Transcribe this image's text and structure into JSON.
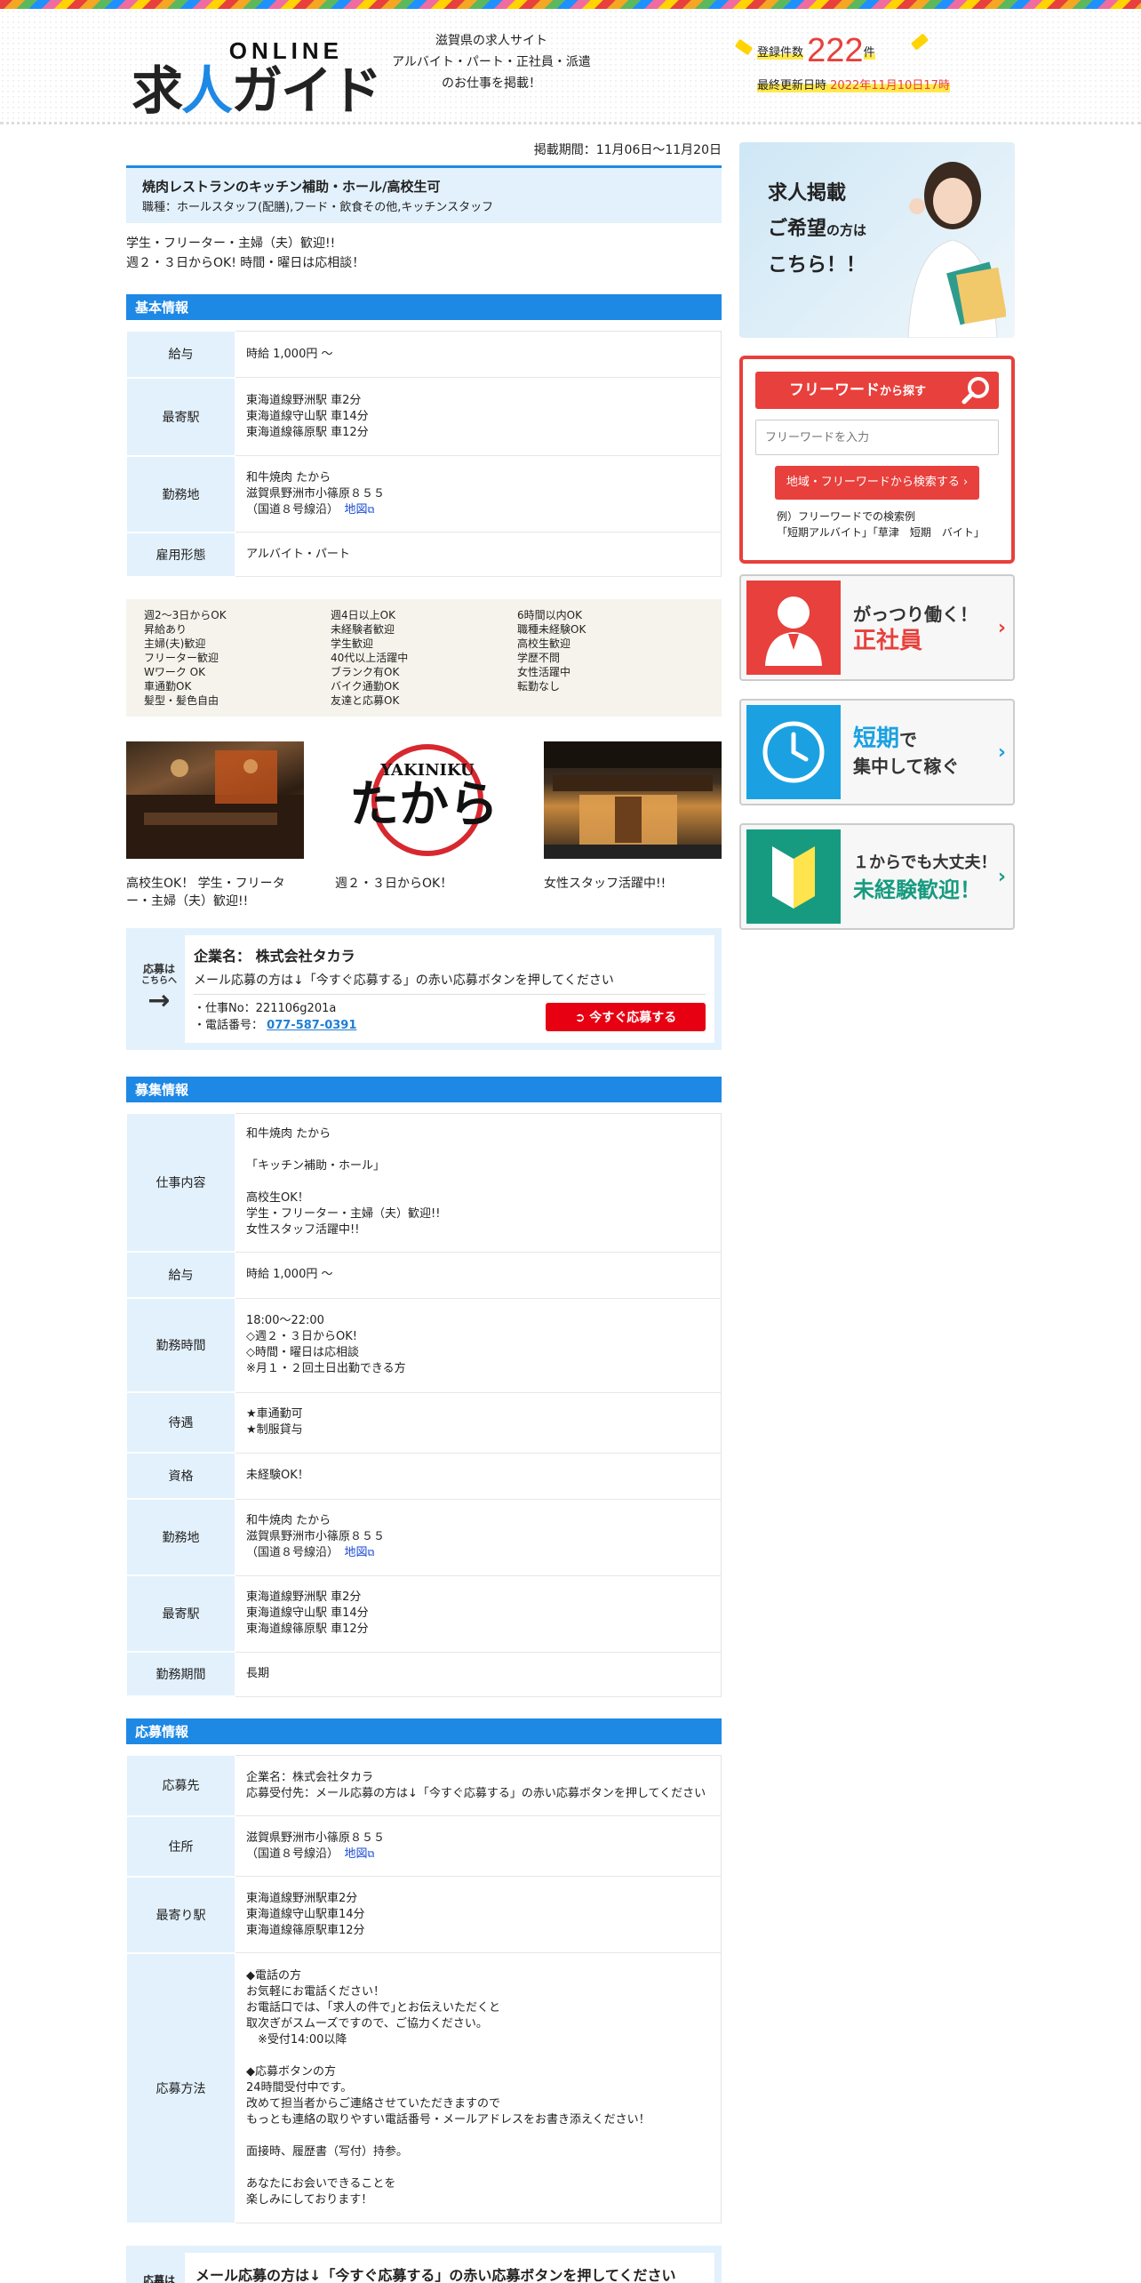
{
  "header": {
    "logo_online": "ONLINE",
    "logo_main_1": "求",
    "logo_main_2": "人",
    "logo_main_3": "ガイド",
    "tagline_1": "滋賀県の求人サイト",
    "tagline_2": "アルバイト・パート・正社員・派遣",
    "tagline_3": "のお仕事を掲載！",
    "count_label": "登録件数",
    "count": "222",
    "count_unit": "件",
    "updated_label": "最終更新日時",
    "updated": "2022年11月10日17時"
  },
  "job": {
    "period": "掲載期間：11月06日～11月20日",
    "title": "焼肉レストランのキッチン補助・ホール/高校生可",
    "subtitle": "職種：ホールスタッフ(配膳),フード・飲食その他,キッチンスタッフ",
    "catch_1": "学生・フリーター・主婦（夫）歓迎!!",
    "catch_2": "週２・３日からOK! 時間・曜日は応相談！"
  },
  "basic": {
    "heading": "基本情報",
    "rows": [
      {
        "label": "給与",
        "value": "時給 1,000円 ～"
      },
      {
        "label": "最寄駅",
        "value": "東海道線野洲駅 車2分\n東海道線守山駅 車14分\n東海道線篠原駅 車12分"
      },
      {
        "label": "勤務地",
        "value": "和牛焼肉 たから\n滋賀県野洲市小篠原８５５\n（国道８号線沿）",
        "map": "地図"
      },
      {
        "label": "雇用形態",
        "value": "アルバイト・パート"
      }
    ]
  },
  "tags": [
    "週2～3日からOK",
    "昇給あり",
    "主婦(夫)歓迎",
    "フリーター歓迎",
    "Wワーク OK",
    "車通勤OK",
    "髪型・髪色自由",
    "週4日以上OK",
    "未経験者歓迎",
    "学生歓迎",
    "40代以上活躍中",
    "ブランク有OK",
    "バイク通勤OK",
    "友達と応募OK",
    "6時間以内OK",
    "職種未経験OK",
    "高校生歓迎",
    "学歴不問",
    "女性活躍中",
    "転勤なし"
  ],
  "photos": [
    {
      "caption": "高校生OK！ 学生・フリーター・主婦（夫）歓迎!!"
    },
    {
      "caption": "週２・３日からOK！",
      "logo_top": "YAKINIKU",
      "logo_main": "たから"
    },
    {
      "caption": "女性スタッフ活躍中!!"
    }
  ],
  "apply_box": {
    "side_label_1": "応募は",
    "side_label_2": "こちらへ",
    "company": "企業名： 株式会社タカラ",
    "note": "メール応募の方は↓「今すぐ応募する」の赤い応募ボタンを押してください",
    "job_no": "・仕事No：221106g201a",
    "tel_label": "・電話番号：",
    "tel": "077-587-0391",
    "button": "今すぐ応募する"
  },
  "recruit": {
    "heading": "募集情報",
    "rows": [
      {
        "label": "仕事内容",
        "value": "和牛焼肉 たから\n\n「キッチン補助・ホール」\n\n高校生OK！\n学生・フリーター・主婦（夫）歓迎!!\n女性スタッフ活躍中!!"
      },
      {
        "label": "給与",
        "value": "時給 1,000円 ～"
      },
      {
        "label": "勤務時間",
        "value": "18:00～22:00\n◇週２・３日からOK!\n◇時間・曜日は応相談\n※月１・２回土日出勤できる方"
      },
      {
        "label": "待遇",
        "value": "★車通勤可\n★制服貸与"
      },
      {
        "label": "資格",
        "value": "未経験OK！"
      },
      {
        "label": "勤務地",
        "value": "和牛焼肉 たから\n滋賀県野洲市小篠原８５５\n（国道８号線沿）",
        "map": "地図"
      },
      {
        "label": "最寄駅",
        "value": "東海道線野洲駅 車2分\n東海道線守山駅 車14分\n東海道線篠原駅 車12分"
      },
      {
        "label": "勤務期間",
        "value": "長期"
      }
    ]
  },
  "application": {
    "heading": "応募情報",
    "rows": [
      {
        "label": "応募先",
        "value": "企業名：株式会社タカラ\n応募受付先：メール応募の方は↓「今すぐ応募する」の赤い応募ボタンを押してください"
      },
      {
        "label": "住所",
        "value": "滋賀県野洲市小篠原８５５\n（国道８号線沿）",
        "map": "地図"
      },
      {
        "label": "最寄り駅",
        "value": "東海道線野洲駅車2分\n東海道線守山駅車14分\n東海道線篠原駅車12分"
      },
      {
        "label": "応募方法",
        "value": "◆電話の方\nお気軽にお電話ください！\nお電話口では、｢求人の件で｣とお伝えいただくと\n取次ぎがスムーズですので、ご協力ください。\n　※受付14:00以降\n\n◆応募ボタンの方\n24時間受付中です。\n改めて担当者からご連絡させていただきますので\nもっとも連絡の取りやすい電話番号・メールアドレスをお書き添えください！\n\n面接時、履歴書（写付）持参。\n\nあなたにお会いできることを\n楽しみにしております！"
      }
    ]
  },
  "bottom_box": {
    "text": "メール応募の方は↓「今すぐ応募する」の赤い応募ボタンを押してください",
    "side_label": "応募は"
  },
  "sidebar": {
    "recruit_line1": "求人掲載",
    "recruit_line2a": "ご希望",
    "recruit_line2b": "の方は",
    "recruit_line3": "こちら！！",
    "search_title": "フリーワード",
    "search_title_small": "から探す",
    "search_placeholder": "フリーワードを入力",
    "search_button": "地域・フリーワードから検索する ›",
    "search_example": "例）フリーワードでの検索例\n「短期アルバイト」「草津　短期　バイト」",
    "banners": [
      {
        "line1": "がっつり働く！",
        "line2": "正社員",
        "color": "#e8403c"
      },
      {
        "line1a": "短期",
        "line1b": "で",
        "line2": "集中して稼ぐ",
        "color": "#1ba1e2"
      },
      {
        "line1": "１からでも大丈夫！",
        "line2": "未経験歓迎！",
        "color": "#179b80"
      }
    ]
  }
}
